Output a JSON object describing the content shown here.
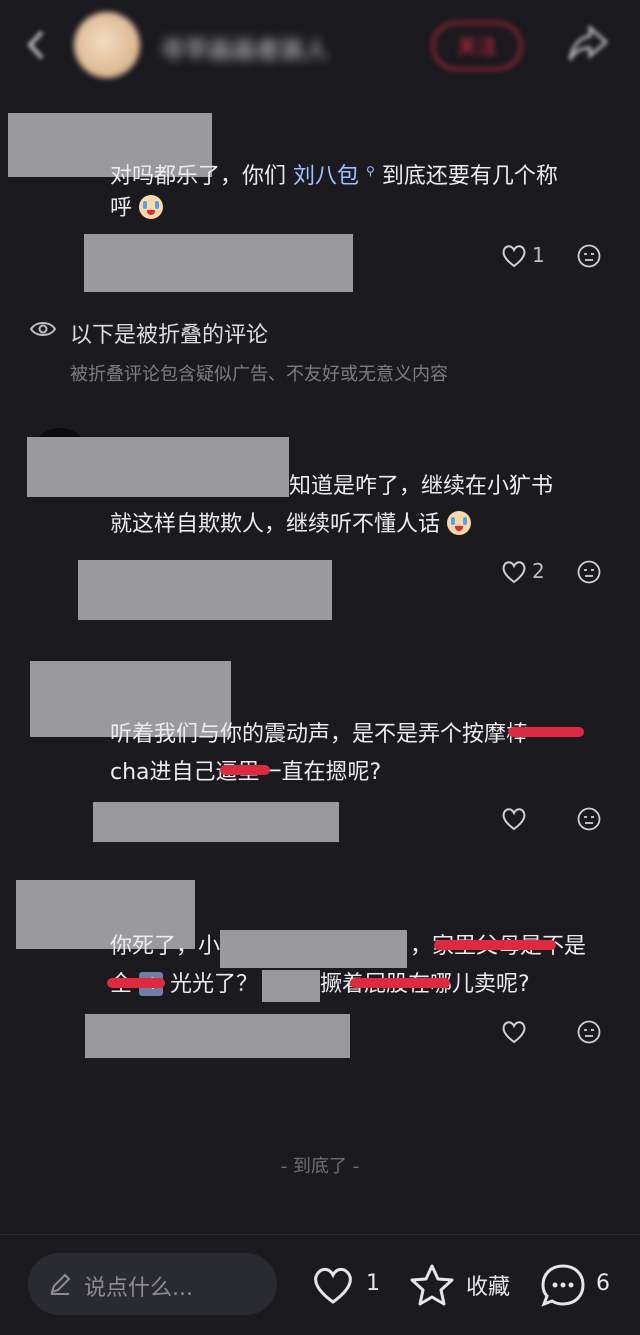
{
  "header": {
    "author_name": "寻早画画者装人",
    "follow_label": "关注"
  },
  "comments": [
    {
      "text_part1": "对吗都乐了，你们",
      "link": "刘八包",
      "text_part2": "到底还要有几个称",
      "text_line2": "呼",
      "likes": "1"
    }
  ],
  "folded": {
    "title": "以下是被折叠的评论",
    "subtitle": "被折叠评论包含疑似广告、不友好或无意义内容"
  },
  "folded_comments": [
    {
      "line1": "知道是咋了，继续在小犷书",
      "line2": "就这样自欺欺人，继续听不懂人话",
      "likes": "2"
    },
    {
      "line1": "听着我们与你的震动声，是不是弄个按摩棒",
      "line2": "cha进自己逼里一直在摁呢?"
    },
    {
      "line1_a": "你死了，小",
      "line1_b": "，家里父母是不是",
      "line2_a": "全",
      "line2_num": "4",
      "line2_b": "光光了？",
      "line2_c": "撅着屁股在哪儿卖呢?"
    }
  ],
  "end_text": "- 到底了 -",
  "bottom_bar": {
    "input_placeholder": "说点什么...",
    "like_count": "1",
    "collect_label": "收藏",
    "comment_count": "6"
  }
}
